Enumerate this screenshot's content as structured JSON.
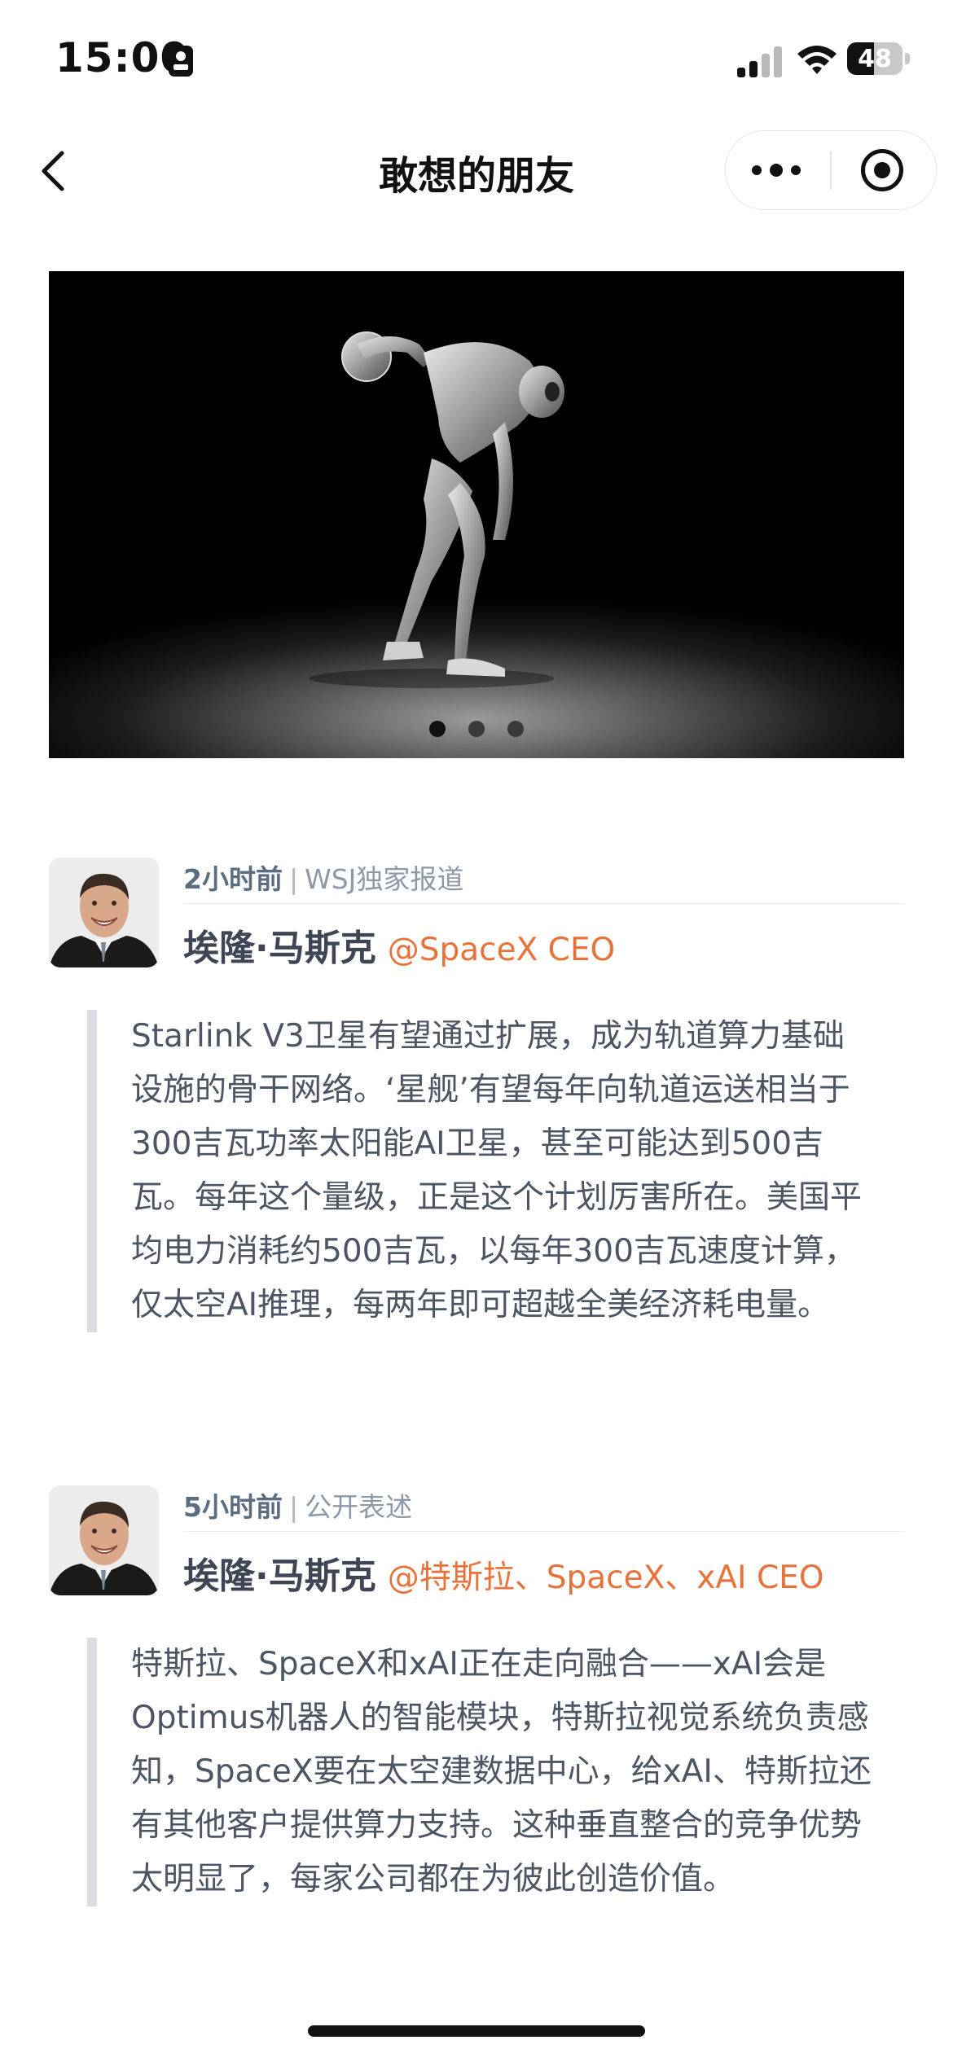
{
  "status_bar": {
    "time": "15:00",
    "battery": "48",
    "battery_fraction": 0.48
  },
  "nav": {
    "title": "敢想的朋友"
  },
  "hero": {
    "description_icon": "robot-discus-thrower-image",
    "slide_count": 3,
    "active_slide": 0
  },
  "posts": [
    {
      "time_ago": "2小时前",
      "separator": "|",
      "source": "WSJ独家报道",
      "author": "埃隆·马斯克",
      "handle": "@SpaceX CEO",
      "quote": "Starlink V3卫星有望通过扩展，成为轨道算力基础设施的骨干网络。‘星舰’有望每年向轨道运送相当于300吉瓦功率太阳能AI卫星，甚至可能达到500吉瓦。每年这个量级，正是这个计划厉害所在。美国平均电力消耗约500吉瓦，以每年300吉瓦速度计算，仅太空AI推理，每两年即可超越全美经济耗电量。"
    },
    {
      "time_ago": "5小时前",
      "separator": "|",
      "source": "公开表述",
      "author": "埃隆·马斯克",
      "handle": "@特斯拉、SpaceX、xAI CEO",
      "quote": "特斯拉、SpaceX和xAI正在走向融合——xAI会是Optimus机器人的智能模块，特斯拉视觉系统负责感知，SpaceX要在太空建数据中心，给xAI、特斯拉还有其他客户提供算力支持。这种垂直整合的竞争优势太明显了，每家公司都在为彼此创造价值。"
    }
  ],
  "colors": {
    "handle": "#e8733a",
    "quote_bar": "#d9dde3",
    "meta": "#5d6d80"
  }
}
